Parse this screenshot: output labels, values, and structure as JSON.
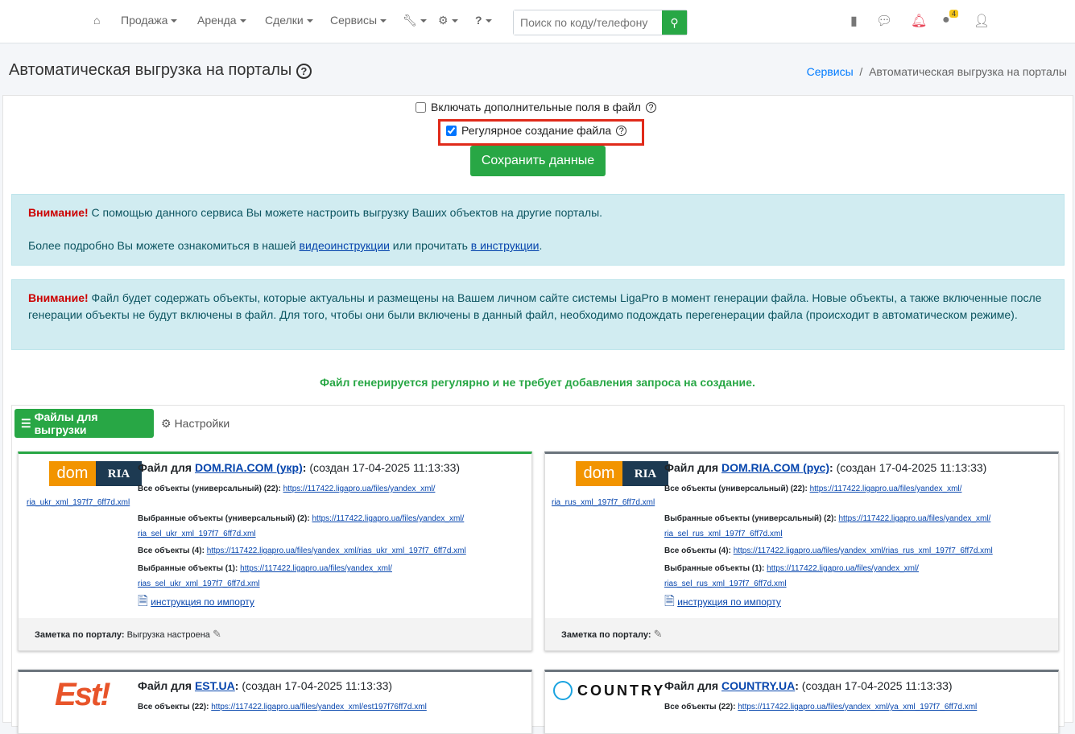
{
  "nav": {
    "items": [
      "Продажа",
      "Аренда",
      "Сделки",
      "Сервисы"
    ],
    "search_placeholder": "Поиск по коду/телефону",
    "badge": "4"
  },
  "page": {
    "title": "Автоматическая выгрузка на порталы",
    "breadcrumb": [
      "Сервисы",
      "Автоматическая выгрузка на порталы"
    ]
  },
  "form": {
    "extra_fields": "Включать дополнительные поля в файл",
    "regular": "Регулярное создание файла",
    "save": "Сохранить данные"
  },
  "alert1": {
    "strong": "Внимание!",
    "text": " С помощью данного сервиса Вы можете настроить выгрузку Ваших объектов на другие порталы.",
    "line2a": "Более подробно Вы можете ознакомиться в нашей ",
    "link1": "видеоинструкции",
    "line2b": " или прочитать ",
    "link2": "в инструкции",
    "line2c": "."
  },
  "alert2": {
    "strong": "Внимание!",
    "text": " Файл будет содержать объекты, которые актуальны и размещены на Вашем личном сайте системы LigaPro в момент генерации файла. Новые объекты, а также включенные после генерации объекты не будут включены в файл. Для того, чтобы они были включены в данный файл, необходимо подождать перегенерации файла (происходит в автоматическом режиме)."
  },
  "green_note": "Файл генерируется регулярно и не требует добавления запроса на создание.",
  "tabs": [
    "Файлы для выгрузки",
    "Настройки"
  ],
  "file_for": "Файл для ",
  "cards": [
    {
      "portal": "DOM.RIA.COM (укр)",
      "created": "(создан 17-04-2025 11:13:33)",
      "rows": [
        {
          "label": "Все объекты (универсальный) (22):",
          "url1": "https://117422.ligapro.ua/files/yandex_xml/",
          "url2": "ria_ukr_xml_197f7_6ff7d.xml"
        },
        {
          "label": "Выбранные объекты (универсальный) (2):",
          "url1": "https://117422.ligapro.ua/files/yandex_xml/",
          "url2": "ria_sel_ukr_xml_197f7_6ff7d.xml"
        },
        {
          "label": "Все объекты (4):",
          "url1": "https://117422.ligapro.ua/files/yandex_xml/rias_ukr_xml_197f7_6ff7d.xml"
        },
        {
          "label": "Выбранные объекты (1):",
          "url1": "https://117422.ligapro.ua/files/yandex_xml/",
          "url2": "rias_sel_ukr_xml_197f7_6ff7d.xml"
        }
      ],
      "instr": "инструкция по импорту",
      "note_label": "Заметка по порталу:",
      "note": " Выгрузка настроена"
    },
    {
      "portal": "DOM.RIA.COM (рус)",
      "created": "(создан 17-04-2025 11:13:33)",
      "rows": [
        {
          "label": "Все объекты (универсальный) (22):",
          "url1": "https://117422.ligapro.ua/files/yandex_xml/",
          "url2": "ria_rus_xml_197f7_6ff7d.xml"
        },
        {
          "label": "Выбранные объекты (универсальный) (2):",
          "url1": "https://117422.ligapro.ua/files/yandex_xml/",
          "url2": "ria_sel_rus_xml_197f7_6ff7d.xml"
        },
        {
          "label": "Все объекты (4):",
          "url1": "https://117422.ligapro.ua/files/yandex_xml/rias_rus_xml_197f7_6ff7d.xml"
        },
        {
          "label": "Выбранные объекты (1):",
          "url1": "https://117422.ligapro.ua/files/yandex_xml/",
          "url2": "rias_sel_rus_xml_197f7_6ff7d.xml"
        }
      ],
      "instr": "инструкция по импорту",
      "note_label": "Заметка по порталу:"
    },
    {
      "portal": "EST.UA",
      "created": "(создан 17-04-2025 11:13:33)",
      "rows": [
        {
          "label": "Все объекты (22):",
          "url1": "https://117422.ligapro.ua/files/yandex_xml/est197f76ff7d.xml"
        }
      ]
    },
    {
      "portal": "COUNTRY.UA",
      "created": "(создан 17-04-2025 11:13:33)",
      "rows": [
        {
          "label": "Все объекты (22):",
          "url1": "https://117422.ligapro.ua/files/yandex_xml/ya_xml_197f7_6ff7d.xml"
        }
      ]
    }
  ],
  "logos": {
    "dom": "dom",
    "ria": "RIA",
    "est": "Est!",
    "country": "COUNTRY"
  }
}
